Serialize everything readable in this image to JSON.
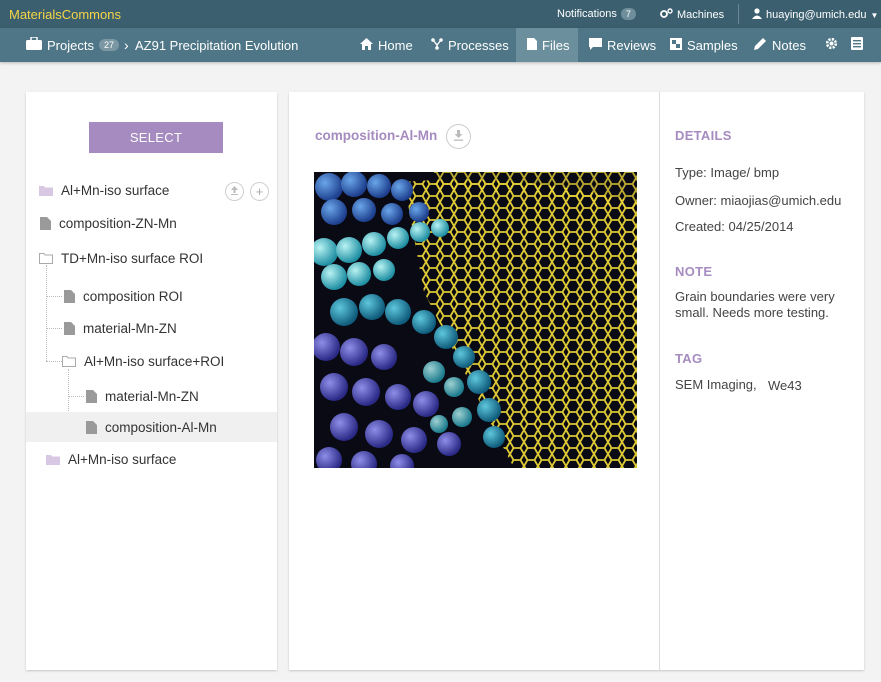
{
  "topbar": {
    "brand": "MaterialsCommons",
    "notifications_label": "Notifications",
    "notifications_count": "7",
    "machines_label": "Machines",
    "user_email": "huaying@umich.edu"
  },
  "nav": {
    "projects_label": "Projects",
    "projects_count": "27",
    "breadcrumb_project": "AZ91 Precipitation Evolution",
    "items": [
      {
        "label": "Home"
      },
      {
        "label": "Processes"
      },
      {
        "label": "Files"
      },
      {
        "label": "Reviews"
      },
      {
        "label": "Samples"
      },
      {
        "label": "Notes"
      }
    ],
    "active": "Files"
  },
  "tree": {
    "select_label": "SELECT",
    "items": [
      {
        "label": "Al+Mn-iso surface",
        "type": "folder-filled"
      },
      {
        "label": "composition-ZN-Mn",
        "type": "file"
      },
      {
        "label": "TD+Mn-iso surface ROI",
        "type": "folder-open"
      },
      {
        "label": "composition ROI",
        "type": "file"
      },
      {
        "label": "material-Mn-ZN",
        "type": "file"
      },
      {
        "label": "Al+Mn-iso surface+ROI",
        "type": "folder-open"
      },
      {
        "label": "material-Mn-ZN",
        "type": "file"
      },
      {
        "label": "composition-Al-Mn",
        "type": "file"
      },
      {
        "label": "Al+Mn-iso surface",
        "type": "folder-filled"
      }
    ],
    "selected": "composition-Al-Mn"
  },
  "file": {
    "title": "composition-Al-Mn"
  },
  "details": {
    "heading": "DETAILS",
    "type_line": "Type: Image/ bmp",
    "owner_line": "Owner: miaojias@umich.edu",
    "created_line": "Created: 04/25/2014",
    "note_heading": "NOTE",
    "note_text": "Grain boundaries were very small. Needs more testing.",
    "tag_heading": "TAG",
    "tags": [
      "SEM Imaging,",
      "We43"
    ]
  },
  "colors": {
    "topbar": "#3b5f6e",
    "navbar": "#4e7686",
    "accent_purple": "#a58bbf",
    "brand_yellow": "#f5d547"
  }
}
